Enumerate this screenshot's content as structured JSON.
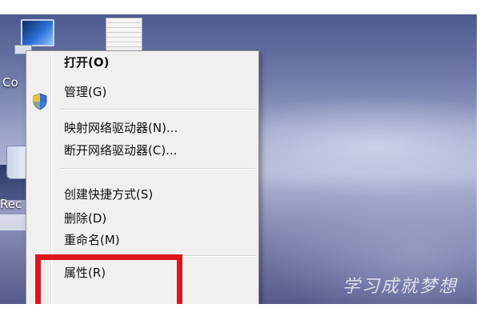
{
  "desktop": {
    "icons": [
      {
        "label": "Co"
      },
      {
        "label": "Rec"
      }
    ]
  },
  "context_menu": {
    "items": [
      {
        "label": "打开(O)",
        "bold": true
      },
      {
        "label": "管理(G)",
        "icon": "uac-shield-icon"
      },
      {
        "label": "映射网络驱动器(N)..."
      },
      {
        "label": "断开网络驱动器(C)..."
      },
      {
        "label": "创建快捷方式(S)"
      },
      {
        "label": "删除(D)"
      },
      {
        "label": "重命名(M)"
      },
      {
        "label": "属性(R)"
      }
    ]
  },
  "annotation": {
    "color": "#e0141c"
  },
  "watermark": {
    "text": "学习成就梦想"
  }
}
